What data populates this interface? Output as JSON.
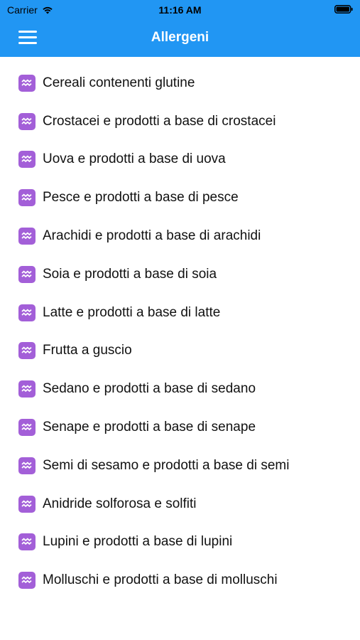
{
  "status_bar": {
    "carrier": "Carrier",
    "time": "11:16 AM"
  },
  "header": {
    "title": "Allergeni",
    "menu_icon": "hamburger-menu-icon"
  },
  "colors": {
    "accent": "#2196F3",
    "icon_background": "#a35fd8"
  },
  "allergens": [
    {
      "label": "Cereali contenenti glutine",
      "icon": "aquarius-icon"
    },
    {
      "label": "Crostacei e prodotti a base di crostacei",
      "icon": "aquarius-icon"
    },
    {
      "label": "Uova e prodotti a base di uova",
      "icon": "aquarius-icon"
    },
    {
      "label": "Pesce e prodotti a base di pesce",
      "icon": "aquarius-icon"
    },
    {
      "label": "Arachidi e prodotti a base di arachidi",
      "icon": "aquarius-icon"
    },
    {
      "label": "Soia e prodotti a base di soia",
      "icon": "aquarius-icon"
    },
    {
      "label": "Latte e prodotti a base di latte",
      "icon": "aquarius-icon"
    },
    {
      "label": "Frutta a guscio",
      "icon": "aquarius-icon"
    },
    {
      "label": "Sedano e prodotti a base di sedano",
      "icon": "aquarius-icon"
    },
    {
      "label": "Senape e prodotti a base di senape",
      "icon": "aquarius-icon"
    },
    {
      "label": "Semi di sesamo e prodotti a base di semi",
      "icon": "aquarius-icon"
    },
    {
      "label": "Anidride solforosa e solfiti",
      "icon": "aquarius-icon"
    },
    {
      "label": "Lupini e prodotti a base di lupini",
      "icon": "aquarius-icon"
    },
    {
      "label": "Molluschi e prodotti a base di molluschi",
      "icon": "aquarius-icon"
    }
  ]
}
